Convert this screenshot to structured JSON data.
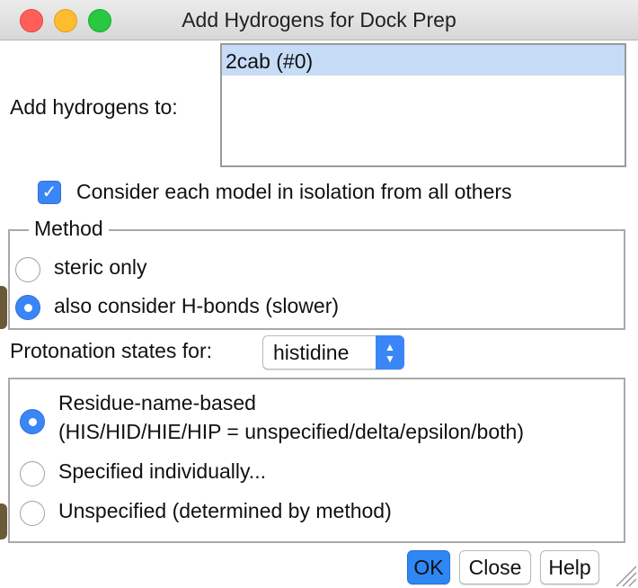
{
  "window": {
    "title": "Add Hydrogens for Dock Prep"
  },
  "targets": {
    "label": "Add hydrogens to:",
    "models": [
      "2cab (#0)"
    ],
    "selected_index": 0
  },
  "isolation": {
    "label": "Consider each model in isolation from all others",
    "checked": true
  },
  "method": {
    "title": "Method",
    "options": [
      "steric only",
      "also consider H-bonds (slower)"
    ],
    "selected_index": 1
  },
  "protonation": {
    "label": "Protonation states for:",
    "residue": "histidine",
    "options": [
      "Residue-name-based",
      "Specified individually...",
      "Unspecified (determined by method)"
    ],
    "option_detail": "(HIS/HID/HIE/HIP = unspecified/delta/epsilon/both)",
    "selected_index": 0
  },
  "buttons": {
    "ok": "OK",
    "close": "Close",
    "help": "Help"
  },
  "colors": {
    "accent": "#3b86f7",
    "selection": "#c6dcf6"
  }
}
